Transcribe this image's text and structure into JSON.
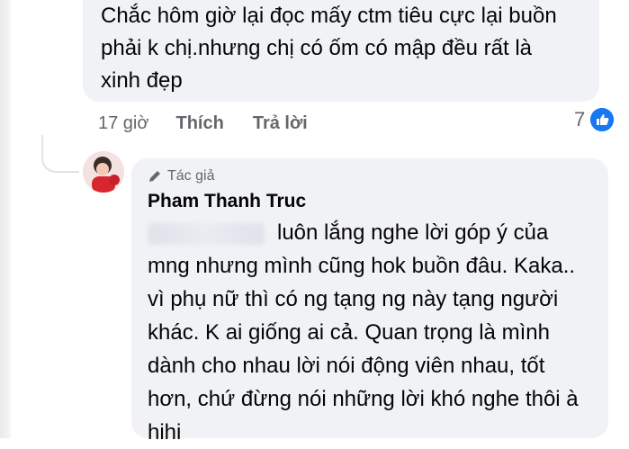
{
  "parent_comment": {
    "lines": [
      "Chắc hôm giờ lại đọc mấy ctm tiêu cực lại buồn",
      "phải k chị.nhưng chị có ốm có mập đều rất là",
      "xinh đẹp"
    ],
    "time": "17 giờ",
    "like_label": "Thích",
    "reply_label": "Trả lời",
    "reaction_count": "7",
    "reaction_icon": "like-icon",
    "accent": "#1877f2"
  },
  "reply": {
    "badge_icon": "pencil-icon",
    "badge_label": "Tác giả",
    "author": "Pham Thanh Truc",
    "first_line_rest": "luôn lắng nghe lời góp ý của",
    "lines": [
      "mng nhưng mình cũng hok buồn đâu. Kaka..",
      "vì phụ nữ thì có ng tạng ng này tạng người",
      "khác. K ai giống ai cả. Quan trọng là mình",
      "dành cho nhau lời nói động viên nhau, tốt",
      "hơn, chứ đừng nói những lời khó nghe thôi à",
      "hihi"
    ]
  }
}
